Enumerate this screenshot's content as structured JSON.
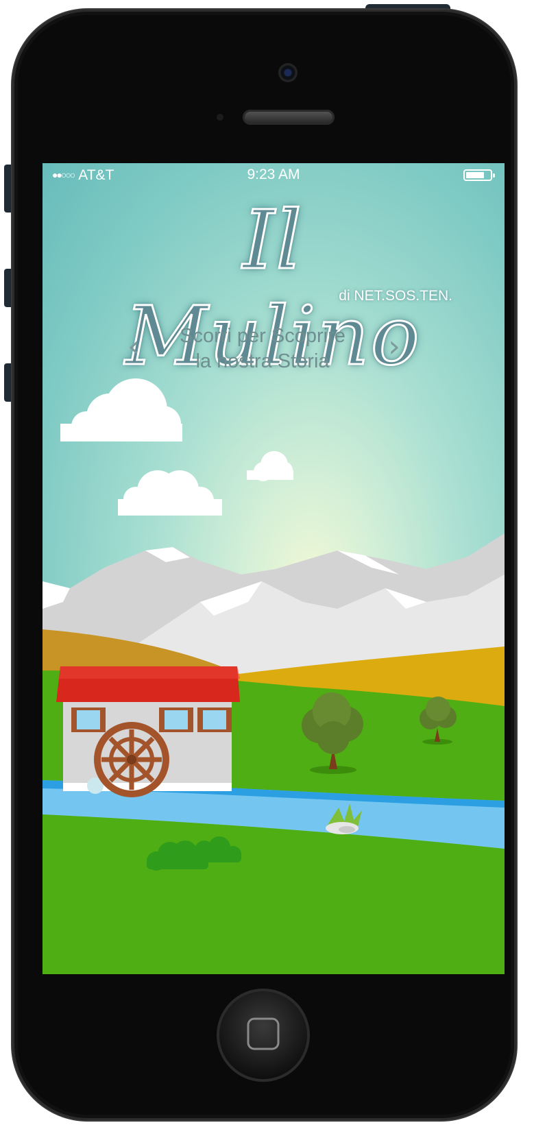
{
  "status_bar": {
    "signal": "●●○○○",
    "carrier": "AT&T",
    "time": "9:23 AM"
  },
  "app": {
    "title": "Il Mulino",
    "subtitle": "di NET.SOS.TEN.",
    "prompt_line1": "Scorri per Scoprire",
    "prompt_line2": "la nostra Storia",
    "prev_arrow": "‹",
    "next_arrow": "›"
  },
  "icons": {
    "battery": "battery-icon",
    "prev": "chevron-left-icon",
    "next": "chevron-right-icon"
  },
  "colors": {
    "sky": "#7fcac4",
    "grass": "#4fae11",
    "river": "#3aa7e6",
    "roof": "#d62b1f",
    "wheel": "#a3542a",
    "mountain": "#d4d4d4"
  }
}
